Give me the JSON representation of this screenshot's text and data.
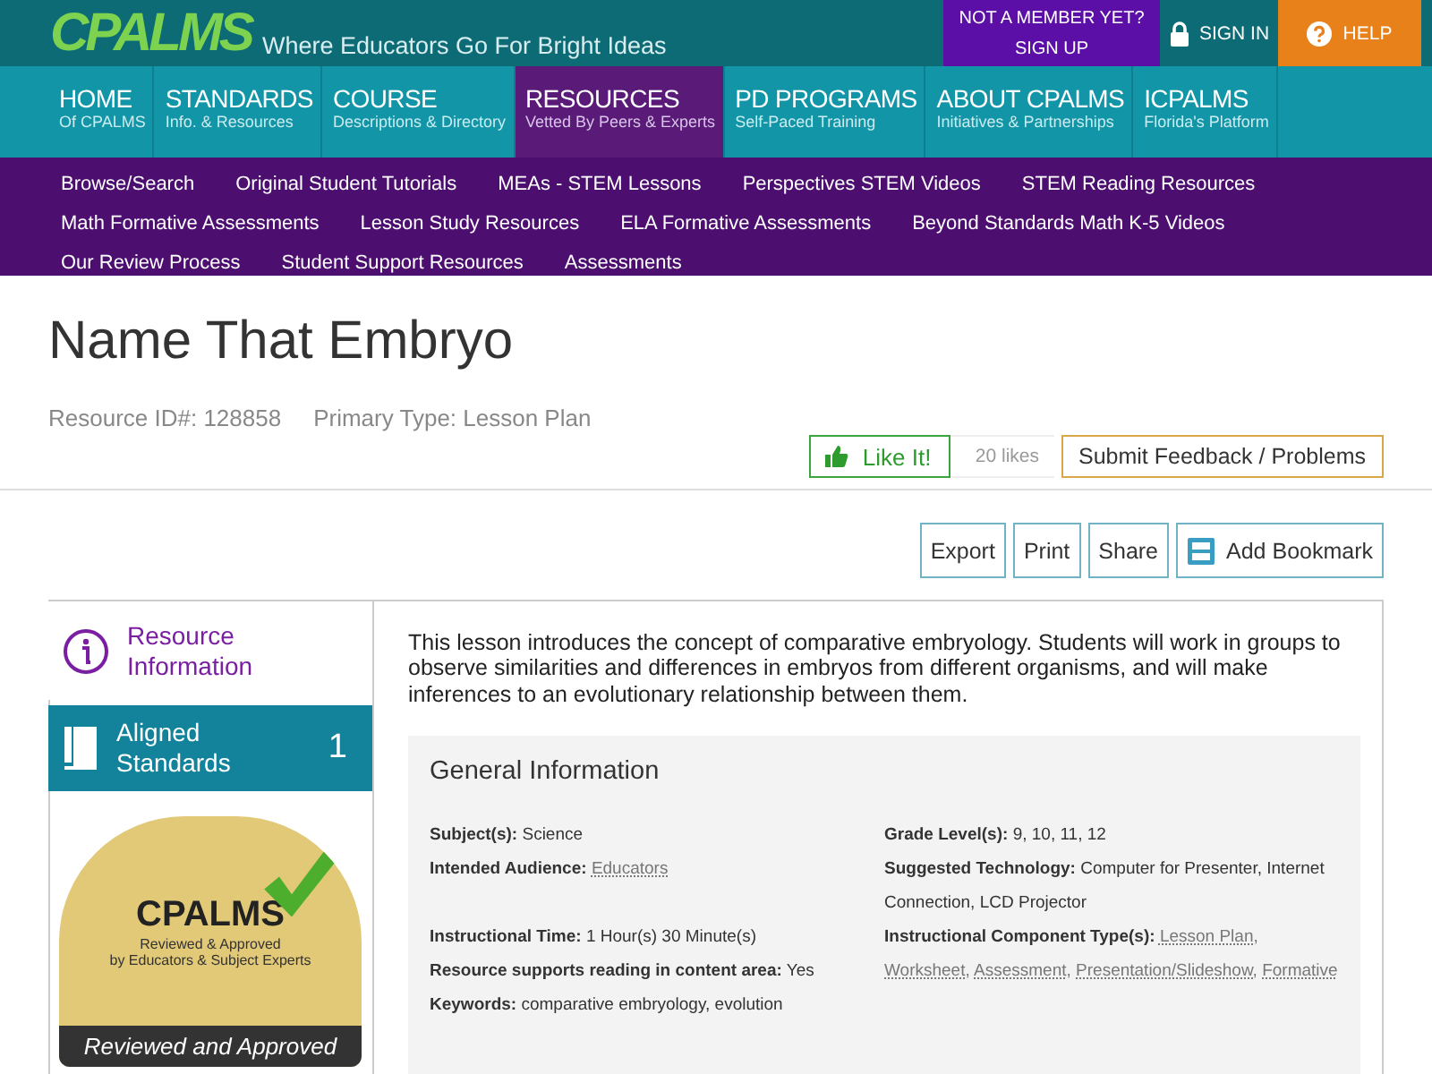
{
  "header": {
    "logo": "CPALMS",
    "tagline": "Where Educators Go For Bright Ideas",
    "member": {
      "line1": "NOT A MEMBER YET?",
      "line2": "SIGN UP"
    },
    "sign_in": "SIGN IN",
    "help": "HELP"
  },
  "nav": [
    {
      "title": "HOME",
      "subtitle": "Of CPALMS",
      "selected": false
    },
    {
      "title": "STANDARDS",
      "subtitle": "Info. & Resources",
      "selected": false
    },
    {
      "title": "COURSE",
      "subtitle": "Descriptions & Directory",
      "selected": false
    },
    {
      "title": "RESOURCES",
      "subtitle": "Vetted By Peers & Experts",
      "selected": true
    },
    {
      "title": "PD PROGRAMS",
      "subtitle": "Self-Paced Training",
      "selected": false
    },
    {
      "title": "ABOUT CPALMS",
      "subtitle": "Initiatives & Partnerships",
      "selected": false
    },
    {
      "title": "ICPALMS",
      "subtitle": "Florida's Platform",
      "selected": false
    }
  ],
  "subnav": [
    [
      "Browse/Search",
      "Original Student Tutorials",
      "MEAs - STEM Lessons",
      "Perspectives STEM Videos",
      "STEM Reading Resources"
    ],
    [
      "Math Formative Assessments",
      "Lesson Study Resources",
      "ELA Formative Assessments",
      "Beyond Standards Math K-5 Videos"
    ],
    [
      "Our Review Process",
      "Student Support Resources",
      "Assessments"
    ]
  ],
  "title": "Name That Embryo",
  "resource_id": "Resource ID#: 128858",
  "primary_type": "Primary Type: Lesson Plan",
  "like_button": "Like It!",
  "likes": "20 likes",
  "feedback_button": "Submit Feedback / Problems",
  "actions": [
    "Export",
    "Print",
    "Share",
    "Add Bookmark"
  ],
  "side_tabs": [
    {
      "kind": "info",
      "label": "Resource Information",
      "selected": true
    },
    {
      "kind": "standards",
      "label": "Aligned Standards",
      "count": "1",
      "selected": false
    }
  ],
  "badge": {
    "logo": "CPALMS",
    "line1": "Reviewed & Approved",
    "line2": "by Educators & Subject Experts",
    "ribbon": "Reviewed and Approved"
  },
  "description": "This lesson introduces the concept of comparative embryology. Students will work in groups to observe similarities and differences in embryos from different organisms, and will make inferences to an evolutionary relationship between them.",
  "general_info": {
    "heading": "General Information",
    "left": [
      {
        "label": "Subject(s):",
        "values": [
          {
            "text": "Science",
            "link": false
          }
        ]
      },
      {
        "label": "Intended Audience:",
        "values": [
          {
            "text": "Educators",
            "link": true
          }
        ]
      },
      {
        "label": "Instructional Time:",
        "values": [
          {
            "text": "1 Hour(s) 30 Minute(s)",
            "link": false
          }
        ]
      },
      {
        "label": "Resource supports reading in content area:",
        "values": [
          {
            "text": "Yes",
            "link": false
          }
        ]
      },
      {
        "label": "Keywords:",
        "values": [
          {
            "text": "comparative embryology, evolution",
            "link": false
          }
        ]
      }
    ],
    "right": [
      {
        "label": "Grade Level(s):",
        "values": [
          {
            "text": "9, 10, 11, 12",
            "link": false
          }
        ]
      },
      {
        "label": "Suggested Technology:",
        "values": [
          {
            "text": "Computer for Presenter, Internet Connection, LCD Projector",
            "link": false
          }
        ]
      },
      {
        "label": "Instructional Component Type(s):",
        "values": [
          {
            "text": "Lesson Plan,",
            "link": true
          },
          {
            "text": "Worksheet,",
            "link": true
          },
          {
            "text": "Assessment,",
            "link": true
          },
          {
            "text": "Presentation/Slideshow,",
            "link": true
          },
          {
            "text": "Formative",
            "link": true
          }
        ]
      }
    ]
  }
}
